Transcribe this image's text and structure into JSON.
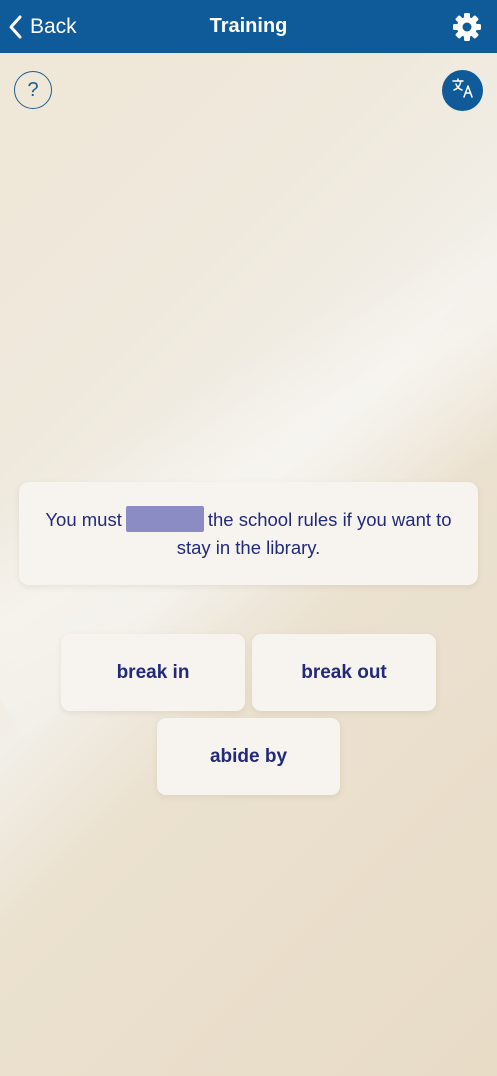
{
  "navbar": {
    "back_label": "Back",
    "title": "Training",
    "settings_icon": "gear-icon",
    "color": "#0f5a98"
  },
  "help": {
    "label": "?",
    "icon": "question-icon"
  },
  "translate": {
    "icon": "translate-icon"
  },
  "question": {
    "before_blank": "You must",
    "after_blank": "the school rules if you want to stay in the library.",
    "blank_color": "#8c8cc4"
  },
  "options": [
    {
      "label": "break in"
    },
    {
      "label": "break out"
    },
    {
      "label": "abide by"
    }
  ],
  "colors": {
    "text_primary": "#232a7a",
    "card_bg": "#f7f4ef"
  }
}
